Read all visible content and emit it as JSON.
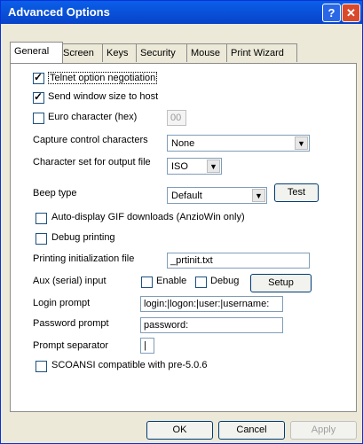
{
  "window": {
    "title": "Advanced Options",
    "help_icon": "?",
    "close_icon": "✕"
  },
  "tabs": [
    {
      "label": "General"
    },
    {
      "label": "Screen"
    },
    {
      "label": "Keys"
    },
    {
      "label": "Security"
    },
    {
      "label": "Mouse"
    },
    {
      "label": "Print Wizard"
    }
  ],
  "general": {
    "telnet_option": {
      "label": "Telnet option negotiation",
      "checked": true
    },
    "send_window_size": {
      "label": "Send window size to host",
      "checked": true
    },
    "euro_character": {
      "label": "Euro character (hex)",
      "checked": false,
      "value": "00"
    },
    "capture_control": {
      "label": "Capture control characters",
      "value": "None"
    },
    "charset_output": {
      "label": "Character set for output file",
      "value": "ISO"
    },
    "beep_type": {
      "label": "Beep type",
      "value": "Default",
      "test_label": "Test"
    },
    "auto_display_gif": {
      "label": "Auto-display GIF downloads (AnzioWin only)",
      "checked": false
    },
    "debug_printing": {
      "label": "Debug printing",
      "checked": false
    },
    "printing_init_file": {
      "label": "Printing initialization file",
      "value": "_prtinit.txt"
    },
    "aux_input": {
      "label": "Aux (serial) input",
      "enable_label": "Enable",
      "debug_label": "Debug",
      "setup_label": "Setup"
    },
    "login_prompt": {
      "label": "Login prompt",
      "value": "login:|logon:|user:|username:"
    },
    "password_prompt": {
      "label": "Password prompt",
      "value": "password:"
    },
    "prompt_separator": {
      "label": "Prompt separator",
      "value": "|"
    },
    "scoansi": {
      "label": "SCOANSI compatible with pre-5.0.6",
      "checked": false
    }
  },
  "footer": {
    "ok_label": "OK",
    "cancel_label": "Cancel",
    "apply_label": "Apply"
  }
}
